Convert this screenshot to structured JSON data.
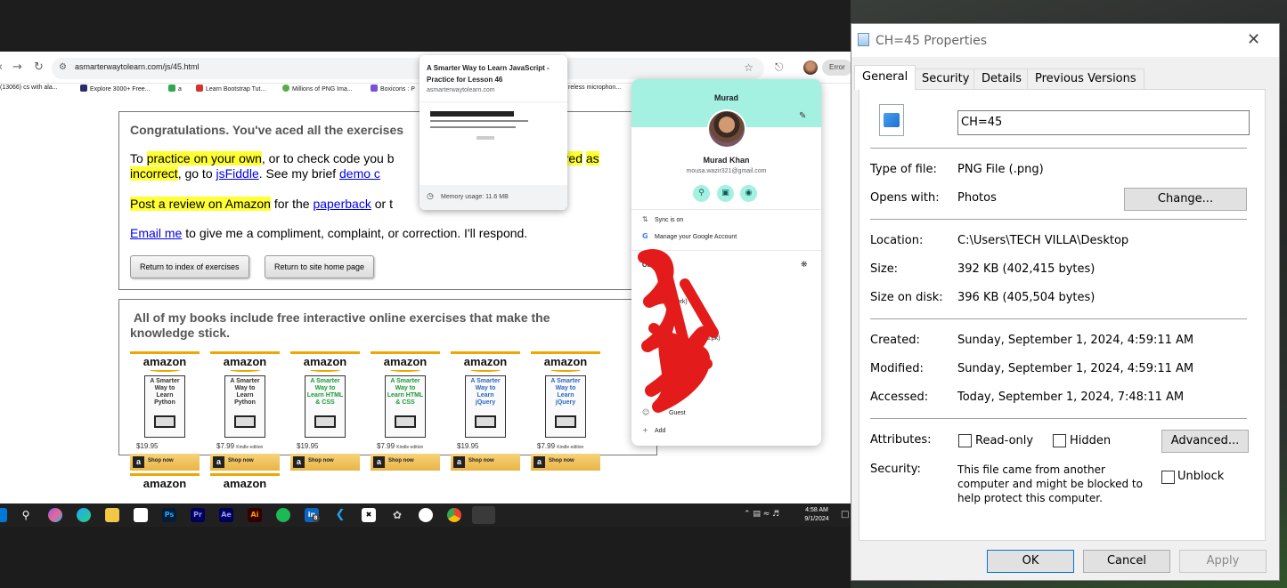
{
  "browser": {
    "url": "asmarterwaytolearn.com/js/45.html",
    "error_chip": "Error",
    "bookmarks": [
      "(13066) cs with ala...",
      "Explore 3000+ Free...",
      "a",
      "Learn Bootstrap Tut...",
      "Millions of PNG Ima...",
      "Boxicons : P",
      "reless microphon..."
    ]
  },
  "page": {
    "congrats": "Congratulations. You've aced all the exercises",
    "p1": {
      "to": "To ",
      "practice": "practice on your own",
      "mid": ", or to check code you b",
      "scored": "en scored",
      "incorrect": "as incorrect",
      "goto": ", go to ",
      "jsfiddle": "jsFiddle",
      "see": ". See my brief ",
      "demo": "demo c"
    },
    "p2": {
      "review": "Post a review on Amazon",
      "for": " for the ",
      "paperback": "paperback",
      "or": " or t"
    },
    "p3": {
      "email": "Email me",
      "rest": " to give me a compliment, complaint, or correction. I'll respond."
    },
    "btn_index": "Return to index of exercises",
    "btn_home": "Return to site home page",
    "books_head": "All of my books include free interactive online exercises that make the knowledge stick.",
    "books": [
      {
        "brand": "amazon",
        "title": "A Smarter Way to Learn Python",
        "price": "$19.95",
        "edition": "",
        "shop": "Shop now",
        "color": "#333333"
      },
      {
        "brand": "amazon",
        "title": "A Smarter Way to Learn Python",
        "price": "$7.99",
        "edition": "Kindle edition",
        "shop": "Shop now",
        "color": "#333333"
      },
      {
        "brand": "amazon",
        "title": "A Smarter Way to Learn HTML & CSS",
        "price": "$19.95",
        "edition": "",
        "shop": "Shop now",
        "color": "#1a9a3a"
      },
      {
        "brand": "amazon",
        "title": "A Smarter Way to Learn HTML & CSS",
        "price": "$7.99",
        "edition": "Kindle edition",
        "shop": "Shop now",
        "color": "#1a9a3a"
      },
      {
        "brand": "amazon",
        "title": "A Smarter Way to Learn jQuery",
        "price": "$19.95",
        "edition": "",
        "shop": "Shop now",
        "color": "#2a66c8"
      },
      {
        "brand": "amazon",
        "title": "A Smarter Way to Learn jQuery",
        "price": "$7.99",
        "edition": "Kindle edition",
        "shop": "Shop now",
        "color": "#2a66c8"
      }
    ],
    "books_row2": [
      "amazon",
      "amazon"
    ]
  },
  "hovercard": {
    "title": "A Smarter Way to Learn JavaScript - Practice for Lesson 46",
    "domain": "asmarterwaytolearn.com",
    "memory": "Memory usage: 11.6 MB"
  },
  "profile": {
    "header_name": "Murad",
    "name": "Murad Khan",
    "email": "mousa.wazir321@gmail.com",
    "sync": "Sync is on",
    "manage": "Manage your Google Account",
    "other_profiles": "Other pro",
    "account_work": "h (Work)",
    "account_edu": "u.pk)",
    "guest": "Guest",
    "add": "Add"
  },
  "taskbar": {
    "time": "4:58 AM",
    "date": "9/1/2024",
    "badge": "8"
  },
  "dialog": {
    "title": "CH=45 Properties",
    "tabs": [
      "General",
      "Security",
      "Details",
      "Previous Versions"
    ],
    "filename": "CH=45",
    "rows": [
      {
        "label": "Type of file:",
        "value": "PNG File (.png)"
      },
      {
        "label": "Opens with:",
        "value": "Photos"
      },
      {
        "label": "Location:",
        "value": "C:\\Users\\TECH VILLA\\Desktop"
      },
      {
        "label": "Size:",
        "value": "392 KB (402,415 bytes)"
      },
      {
        "label": "Size on disk:",
        "value": "396 KB (405,504 bytes)"
      },
      {
        "label": "Created:",
        "value": "Sunday, September 1, 2024, 4:59:11 AM"
      },
      {
        "label": "Modified:",
        "value": "Sunday, September 1, 2024, 4:59:11 AM"
      },
      {
        "label": "Accessed:",
        "value": "Today, September 1, 2024, 7:48:11 AM"
      }
    ],
    "attributes_label": "Attributes:",
    "readonly": "Read-only",
    "hidden": "Hidden",
    "advanced": "Advanced...",
    "change": "Change...",
    "security_label": "Security:",
    "security_text": "This file came from another computer and might be blocked to help protect this computer.",
    "unblock": "Unblock",
    "ok": "OK",
    "cancel": "Cancel",
    "apply": "Apply"
  }
}
